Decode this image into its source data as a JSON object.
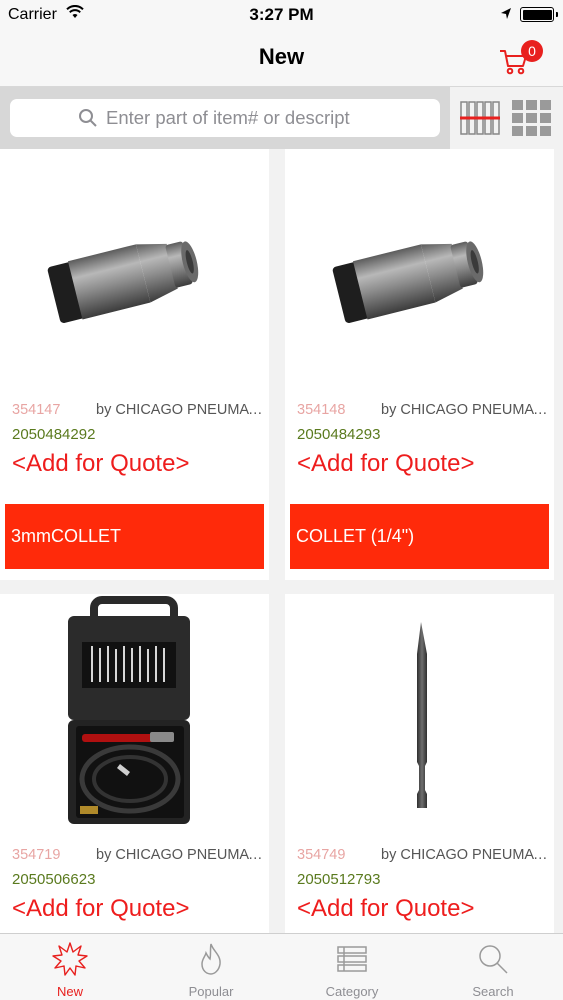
{
  "status_bar": {
    "carrier": "Carrier",
    "time": "3:27 PM"
  },
  "nav": {
    "title": "New",
    "cart_count": "0"
  },
  "search": {
    "placeholder": "Enter part of item# or descript"
  },
  "products": [
    {
      "sku": "354147",
      "brand": "by CHICAGO PNEUMATIC",
      "code": "2050484292",
      "action": "<Add for Quote>",
      "name": "3mmCOLLET",
      "image": "collet-image"
    },
    {
      "sku": "354148",
      "brand": "by CHICAGO PNEUMATIC",
      "code": "2050484293",
      "action": "<Add for Quote>",
      "name": "COLLET (1/4\")",
      "image": "collet-image"
    },
    {
      "sku": "354719",
      "brand": "by CHICAGO PNEUMATIC",
      "code": "2050506623",
      "action": "<Add for Quote>",
      "name": "",
      "image": "die-grinder-kit-image"
    },
    {
      "sku": "354749",
      "brand": "by CHICAGO PNEUMATIC",
      "code": "2050512793",
      "action": "<Add for Quote>",
      "name": "",
      "image": "chisel-image"
    }
  ],
  "tabs": [
    {
      "label": "New",
      "icon": "starburst-icon",
      "active": true
    },
    {
      "label": "Popular",
      "icon": "flame-icon",
      "active": false
    },
    {
      "label": "Category",
      "icon": "category-list-icon",
      "active": false
    },
    {
      "label": "Search",
      "icon": "search-icon",
      "active": false
    }
  ],
  "colors": {
    "accent": "#e8201e",
    "name_bar": "#ff2a0a",
    "sku": "#e8a5a3",
    "code": "#5a7a1e"
  }
}
